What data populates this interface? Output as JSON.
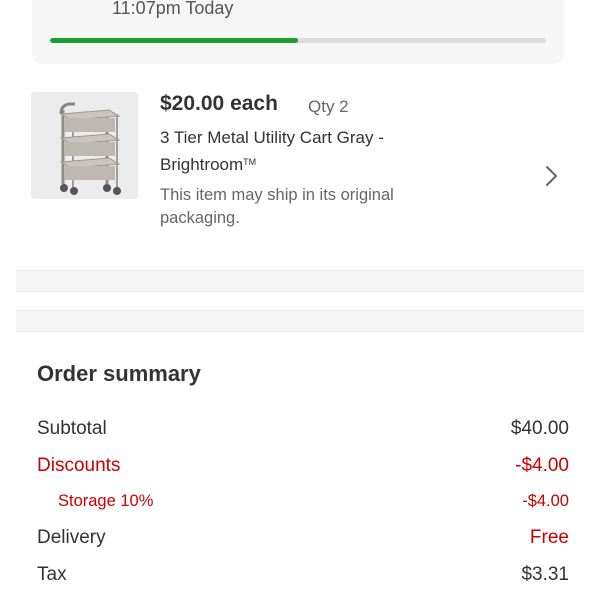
{
  "status": {
    "time_text": "11:07pm Today",
    "progress_fraction": 0.5,
    "progress_color": "#1a9e2c"
  },
  "item": {
    "price": "$20.00 each",
    "qty": "Qty 2",
    "title": "3 Tier Metal Utility Cart Gray - Brightroom",
    "trademark": "TM",
    "note": "This item may ship in its original packaging.",
    "thumbnail_icon": "utility-cart-image",
    "chevron_icon": "chevron-right-icon"
  },
  "summary": {
    "title": "Order summary",
    "rows": {
      "subtotal": {
        "label": "Subtotal",
        "value": "$40.00"
      },
      "discounts": {
        "label": "Discounts",
        "value": "-$4.00"
      },
      "storage": {
        "label": "Storage 10%",
        "value": "-$4.00"
      },
      "delivery": {
        "label": "Delivery",
        "value": "Free"
      },
      "tax": {
        "label": "Tax",
        "value": "$3.31"
      }
    }
  },
  "colors": {
    "accent_red": "#cc0000",
    "text_dark": "#333333",
    "text_muted": "#666666"
  }
}
